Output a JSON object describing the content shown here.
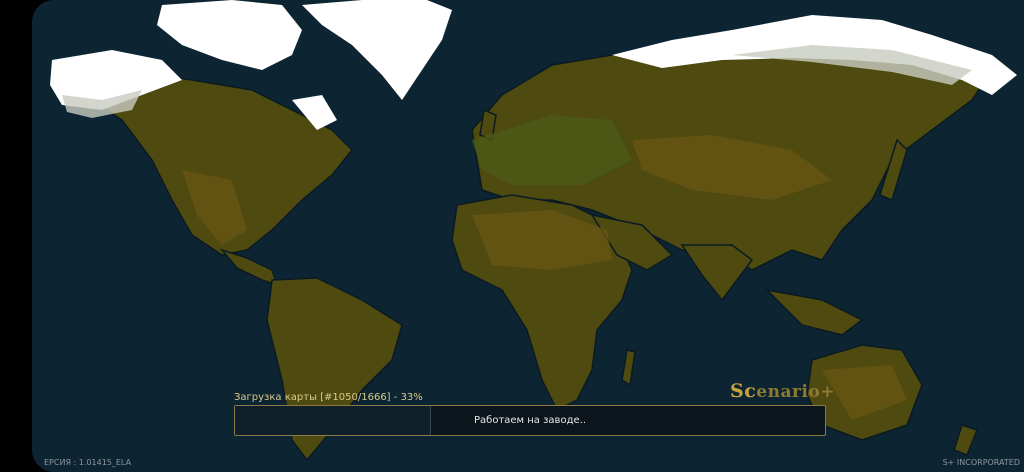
{
  "loading": {
    "label": "Загрузка карты [#1050/1666] -",
    "percent_text": "33%",
    "progress": 0.33,
    "status": "Работаем на заводе.."
  },
  "logo": {
    "prefix": "Sc",
    "rest": "enario+"
  },
  "footer": {
    "version": "ЕРСИЯ : 1.01415_ELA",
    "company": "S+ INCORPORATED"
  },
  "colors": {
    "ocean": "#0d2533",
    "land": "#4f4a10",
    "land_dark": "#5c4d14",
    "ice": "#ffffff",
    "accent": "#8a7a46"
  }
}
